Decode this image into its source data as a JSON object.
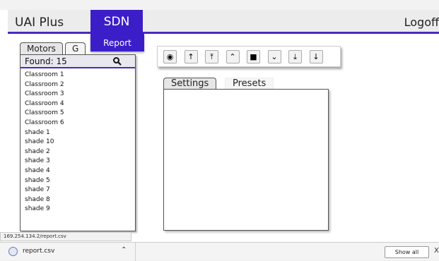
{
  "header": {
    "app_title": "UAI Plus",
    "active_menu": "SDN",
    "menu_dropdown_item": "Report",
    "logoff_label": "Logoff"
  },
  "left_panel": {
    "tabs": [
      "Motors",
      "G"
    ],
    "found_label": "Found: 15",
    "items": [
      "Classroom 1",
      "Classroom 2",
      "Classroom 3",
      "Classroom 4",
      "Classroom 5",
      "Classroom 6",
      "shade 1",
      "shade 10",
      "shade 2",
      "shade 3",
      "shade 4",
      "shade 5",
      "shade 7",
      "shade 8",
      "shade 9"
    ]
  },
  "toolbar": {
    "buttons": [
      {
        "name": "view-icon",
        "glyph": "◉"
      },
      {
        "name": "arrow-up-icon",
        "glyph": "↑"
      },
      {
        "name": "arrow-up-top-icon",
        "glyph": "⤒"
      },
      {
        "name": "chevron-up-icon",
        "glyph": "⌃"
      },
      {
        "name": "stop-icon",
        "glyph": "■"
      },
      {
        "name": "chevron-down-icon",
        "glyph": "⌄"
      },
      {
        "name": "arrow-down-bottom-icon",
        "glyph": "⤓"
      },
      {
        "name": "arrow-down-icon",
        "glyph": "↓"
      }
    ]
  },
  "right_panel": {
    "tabs": [
      "Settings",
      "Presets"
    ]
  },
  "status_bar": {
    "url": "169.254.134.2/report.csv"
  },
  "download_bar": {
    "file_name": "report.csv",
    "show_all_label": "Show all",
    "close_glyph": "X"
  },
  "colors": {
    "accent": "#3c1ec8"
  }
}
